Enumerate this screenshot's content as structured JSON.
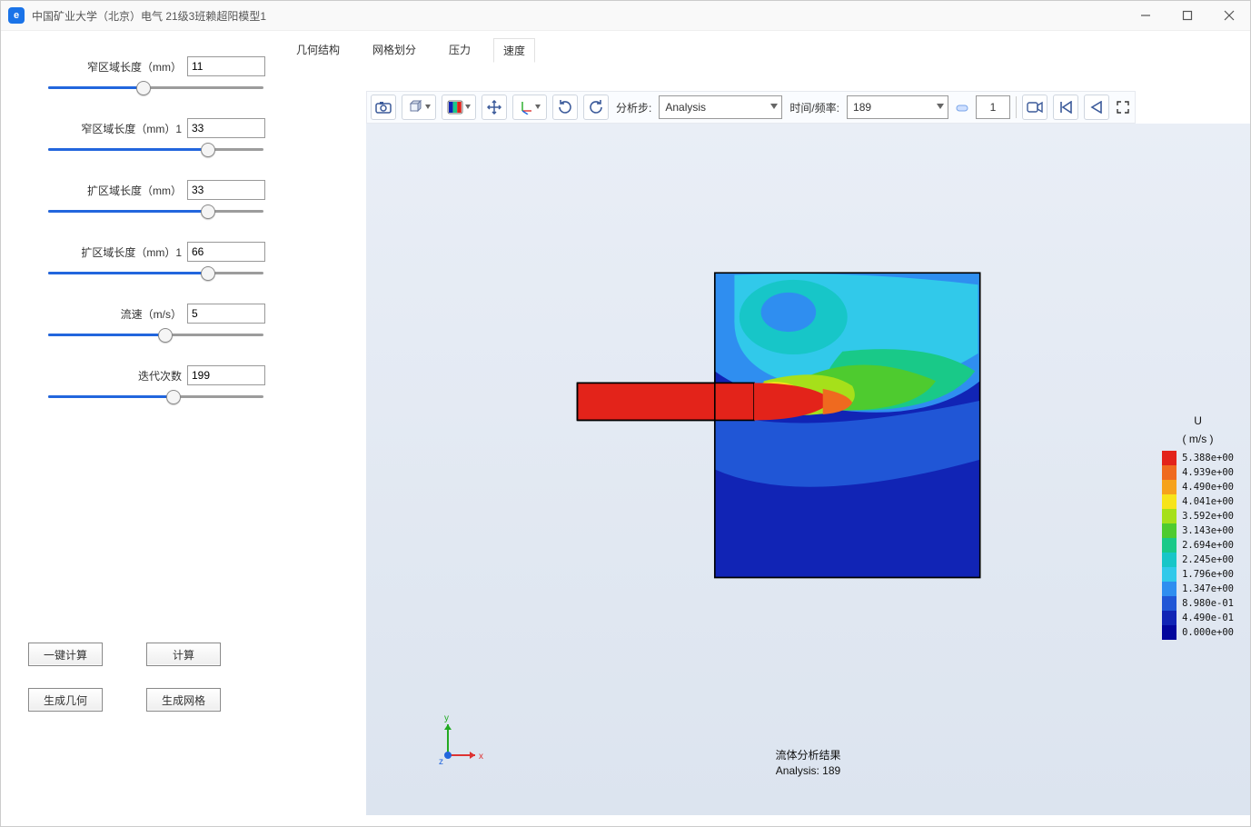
{
  "window": {
    "title": "中国矿业大学（北京）电气 21级3班赖超阳模型1"
  },
  "sidebar": {
    "params": [
      {
        "label": "窄区域长度（mm）",
        "value": "11",
        "fill": 44
      },
      {
        "label": "窄区域长度（mm）1",
        "value": "33",
        "fill": 74
      },
      {
        "label": "扩区域长度（mm）",
        "value": "33",
        "fill": 74
      },
      {
        "label": "扩区域长度（mm）1",
        "value": "66",
        "fill": 74
      },
      {
        "label": "流速（m/s）",
        "value": "5",
        "fill": 54
      },
      {
        "label": "迭代次数",
        "value": "199",
        "fill": 58
      }
    ],
    "buttons": {
      "one_click": "一键计算",
      "calc": "计算",
      "gen_geom": "生成几何",
      "gen_mesh": "生成网格"
    }
  },
  "tabs": [
    "几何结构",
    "网格划分",
    "压力",
    "速度"
  ],
  "active_tab": 3,
  "toolbar": {
    "analysis_step_label": "分析步:",
    "analysis_step_value": "Analysis",
    "time_freq_label": "时间/频率:",
    "time_freq_value": "189",
    "spin_value": "1"
  },
  "result": {
    "line1": "流体分析结果",
    "line2": "Analysis: 189"
  },
  "legend": {
    "title": "U",
    "unit": "( m/s )",
    "entries": [
      {
        "c": "#e3231a",
        "t": "5.388e+00"
      },
      {
        "c": "#ef6a1f",
        "t": "4.939e+00"
      },
      {
        "c": "#f6a21c",
        "t": "4.490e+00"
      },
      {
        "c": "#f7e41a",
        "t": "4.041e+00"
      },
      {
        "c": "#a6e01a",
        "t": "3.592e+00"
      },
      {
        "c": "#4ecb2f",
        "t": "3.143e+00"
      },
      {
        "c": "#19c988",
        "t": "2.694e+00"
      },
      {
        "c": "#17c6c8",
        "t": "2.245e+00"
      },
      {
        "c": "#31c9ea",
        "t": "1.796e+00"
      },
      {
        "c": "#2f8ef0",
        "t": "1.347e+00"
      },
      {
        "c": "#2056d6",
        "t": "8.980e-01"
      },
      {
        "c": "#1124b5",
        "t": "4.490e-01"
      },
      {
        "c": "#03069d",
        "t": "0.000e+00"
      }
    ]
  },
  "triad_labels": {
    "x": "x",
    "y": "y",
    "z": "z"
  },
  "chart_data": {
    "type": "heatmap",
    "title": "流体分析结果",
    "subtitle": "Analysis: 189",
    "scalar_name": "U",
    "scalar_unit": "m/s",
    "color_scale": [
      {
        "value": 5.388,
        "color": "#e3231a"
      },
      {
        "value": 4.939,
        "color": "#ef6a1f"
      },
      {
        "value": 4.49,
        "color": "#f6a21c"
      },
      {
        "value": 4.041,
        "color": "#f7e41a"
      },
      {
        "value": 3.592,
        "color": "#a6e01a"
      },
      {
        "value": 3.143,
        "color": "#4ecb2f"
      },
      {
        "value": 2.694,
        "color": "#19c988"
      },
      {
        "value": 2.245,
        "color": "#17c6c8"
      },
      {
        "value": 1.796,
        "color": "#31c9ea"
      },
      {
        "value": 1.347,
        "color": "#2f8ef0"
      },
      {
        "value": 0.898,
        "color": "#2056d6"
      },
      {
        "value": 0.449,
        "color": "#1124b5"
      },
      {
        "value": 0.0,
        "color": "#03069d"
      }
    ],
    "range": [
      0.0,
      5.388
    ],
    "geometry": {
      "narrow_channel_mm": 11,
      "narrow_channel_mm_1": 33,
      "expansion_mm": 33,
      "expansion_mm_1": 66,
      "inlet_velocity_m_s": 5,
      "iterations": 199
    },
    "note": "2-D CFD velocity-magnitude contour: a narrow inlet jet (high U ~5.4 m/s, red) enters a larger expansion chamber; upper region shows recirculating mid-range velocity (2–3 m/s, cyan/green); lower region and far walls near-zero velocity (dark blue)."
  }
}
